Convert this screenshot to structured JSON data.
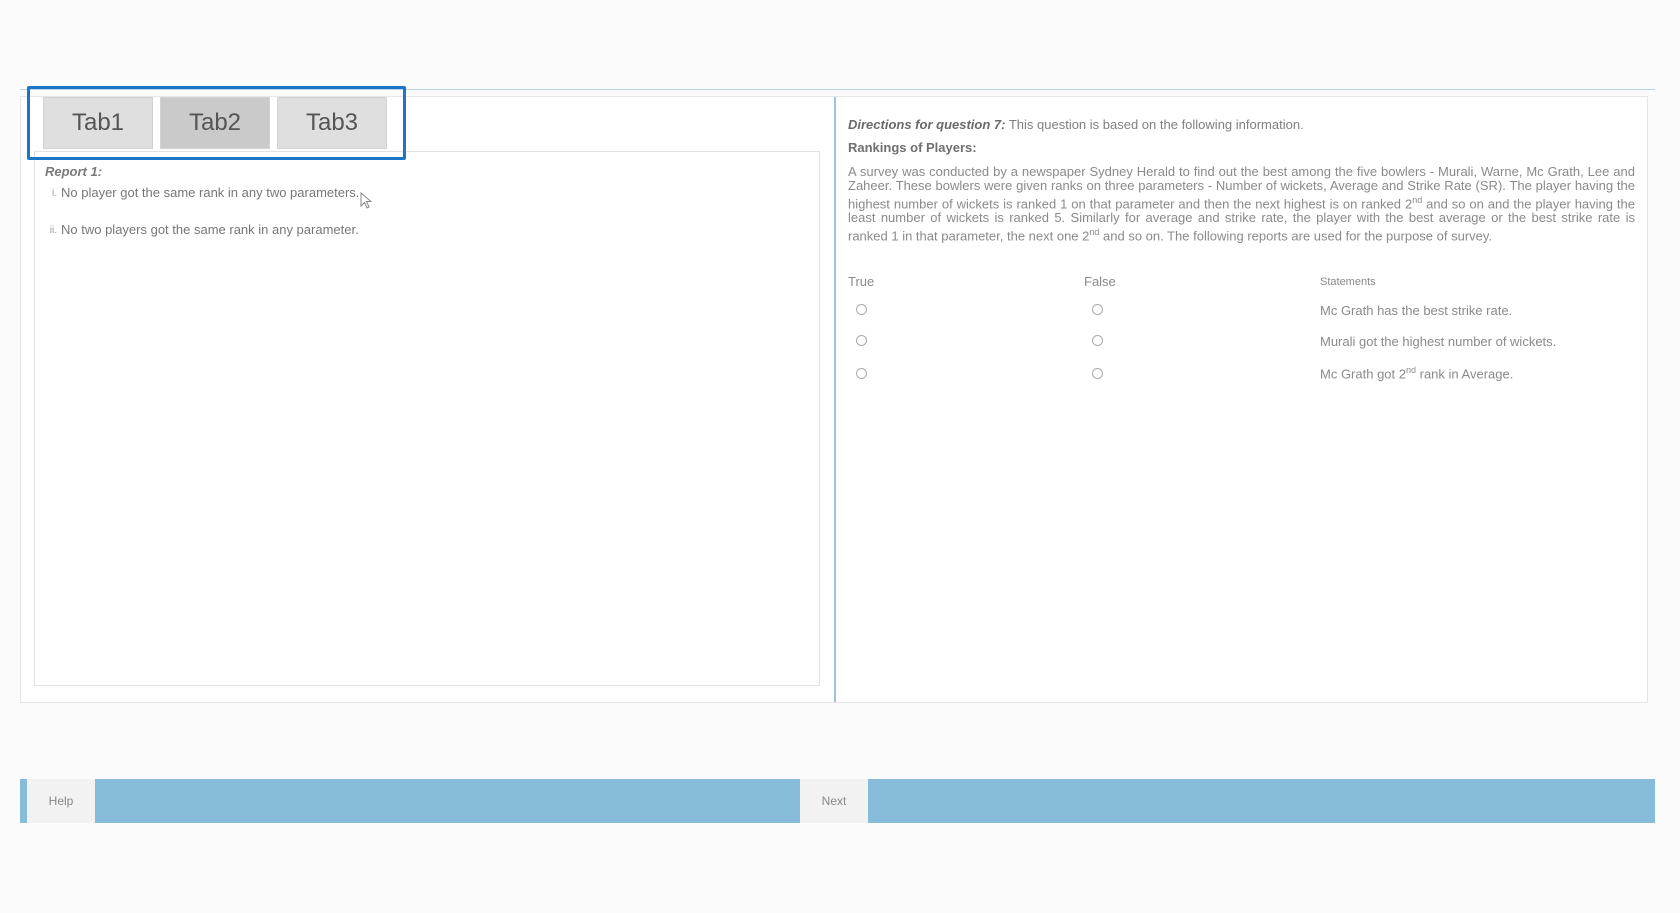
{
  "tabs": [
    {
      "label": "Tab1"
    },
    {
      "label": "Tab2"
    },
    {
      "label": "Tab3"
    }
  ],
  "report": {
    "title": "Report 1:",
    "items": [
      {
        "num": "i.",
        "text": "No player got the same rank in any two parameters."
      },
      {
        "num": "ii.",
        "text": "No two players got the same rank in any parameter."
      }
    ]
  },
  "question": {
    "directions_label": "Directions for question 7:",
    "directions_text": " This question is based on the following information.",
    "rankings_title": "Rankings of Players:",
    "para_1": "A survey was conducted by a newspaper Sydney Herald to find out the best among the five bowlers - Murali, Warne, Mc Grath, Lee and Zaheer. These bowlers were given ranks on three parameters - Number of wickets, Average and Strike Rate (SR). The player having the highest number of wickets is ranked 1 on that parameter and then the next highest is on ranked 2",
    "para_sup_1": "nd",
    "para_2": " and so on and the player having the least number of wickets is ranked 5. Similarly for average and strike rate, the player with the best average or the best strike rate is ranked 1 in that parameter, the next one 2",
    "para_sup_2": "nd",
    "para_3": " and so on. The following reports are used for the purpose of survey."
  },
  "table": {
    "true_header": "True",
    "false_header": "False",
    "statements_header": "Statements",
    "statements": [
      {
        "text": "Mc Grath has the best strike rate."
      },
      {
        "text": "Murali got the highest number of wickets."
      },
      {
        "text_pre": "Mc Grath got 2",
        "sup": "nd",
        "text_post": " rank in Average."
      }
    ]
  },
  "footer": {
    "help_label": "Help",
    "next_label": "Next"
  },
  "colors": {
    "tab_highlight": "#1d75c5",
    "footer_bar": "#87bbda",
    "divider": "#9cc4e2"
  }
}
